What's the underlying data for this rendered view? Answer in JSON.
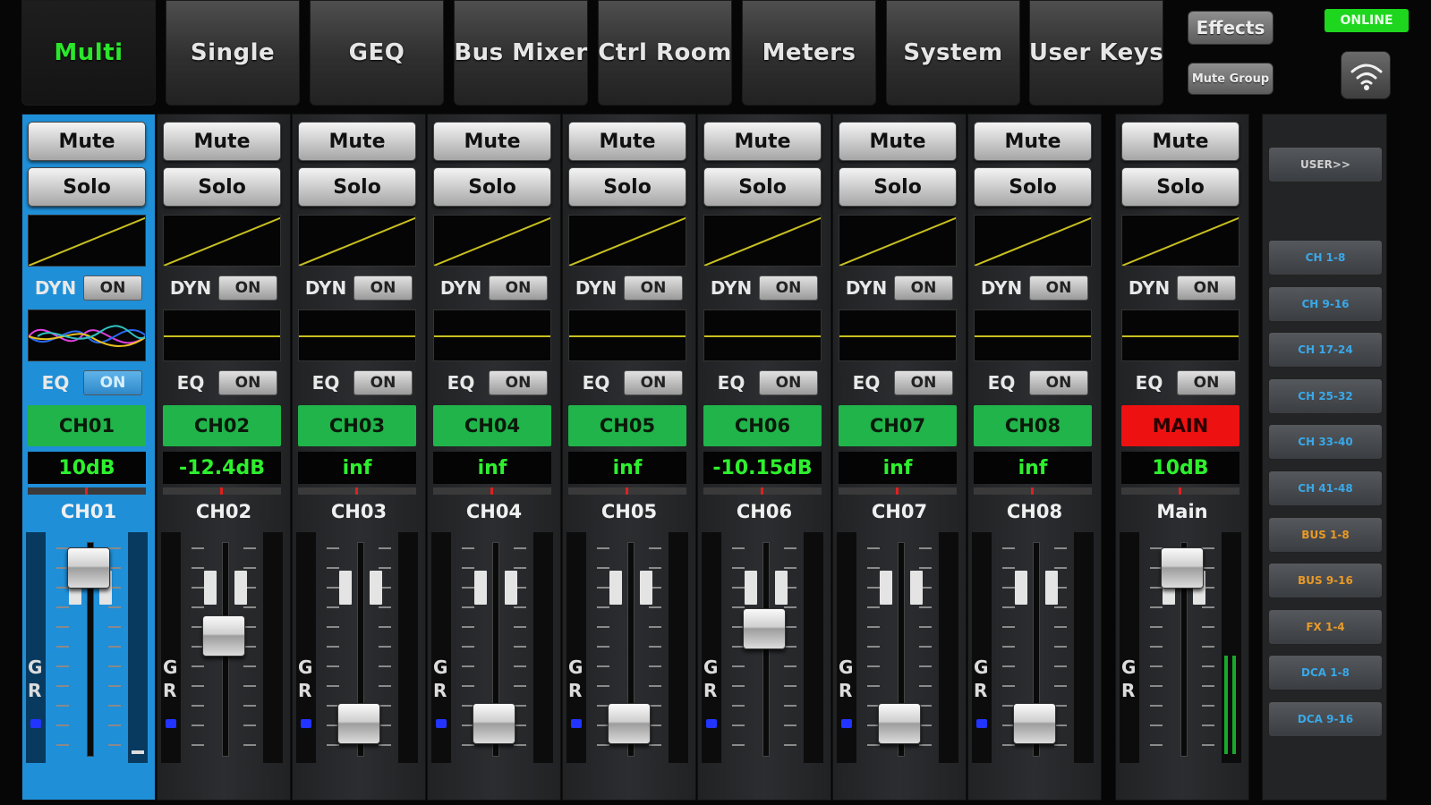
{
  "tabs": [
    {
      "label": "Multi",
      "active": true
    },
    {
      "label": "Single"
    },
    {
      "label": "GEQ"
    },
    {
      "label": "Bus Mixer"
    },
    {
      "label": "Ctrl Room"
    },
    {
      "label": "Meters"
    },
    {
      "label": "System"
    },
    {
      "label": "User Keys"
    }
  ],
  "effects_label": "Effects",
  "mute_group_label": "Mute Group",
  "status": "ONLINE",
  "strip_labels": {
    "mute": "Mute",
    "solo": "Solo",
    "dyn": "DYN",
    "eq": "EQ",
    "on": "ON",
    "g": "G",
    "r": "R"
  },
  "channels": [
    {
      "name": "CH01",
      "gain": "10dB",
      "label": "CH01",
      "fader_level": 0.93,
      "selected": true
    },
    {
      "name": "CH02",
      "gain": "-12.4dB",
      "label": "CH02",
      "fader_level": 0.56
    },
    {
      "name": "CH03",
      "gain": "inf",
      "label": "CH03",
      "fader_level": 0.08
    },
    {
      "name": "CH04",
      "gain": "inf",
      "label": "CH04",
      "fader_level": 0.08
    },
    {
      "name": "CH05",
      "gain": "inf",
      "label": "CH05",
      "fader_level": 0.08
    },
    {
      "name": "CH06",
      "gain": "-10.15dB",
      "label": "CH06",
      "fader_level": 0.6
    },
    {
      "name": "CH07",
      "gain": "inf",
      "label": "CH07",
      "fader_level": 0.08
    },
    {
      "name": "CH08",
      "gain": "inf",
      "label": "CH08",
      "fader_level": 0.08
    },
    {
      "name": "MAIN",
      "gain": "10dB",
      "label": "Main",
      "fader_level": 0.93,
      "main": true
    }
  ],
  "sidebar": {
    "user_label": "USER>>",
    "banks": [
      {
        "label": "CH 1-8",
        "color": "#3aa8e8"
      },
      {
        "label": "CH 9-16",
        "color": "#3aa8e8"
      },
      {
        "label": "CH 17-24",
        "color": "#3aa8e8"
      },
      {
        "label": "CH 25-32",
        "color": "#3aa8e8"
      },
      {
        "label": "CH 33-40",
        "color": "#3aa8e8"
      },
      {
        "label": "CH 41-48",
        "color": "#3aa8e8"
      },
      {
        "label": "BUS 1-8",
        "color": "#e89a28"
      },
      {
        "label": "BUS 9-16",
        "color": "#e89a28"
      },
      {
        "label": "FX 1-4",
        "color": "#e89a28"
      },
      {
        "label": "DCA 1-8",
        "color": "#3aa8e8"
      },
      {
        "label": "DCA 9-16",
        "color": "#3aa8e8"
      }
    ]
  }
}
